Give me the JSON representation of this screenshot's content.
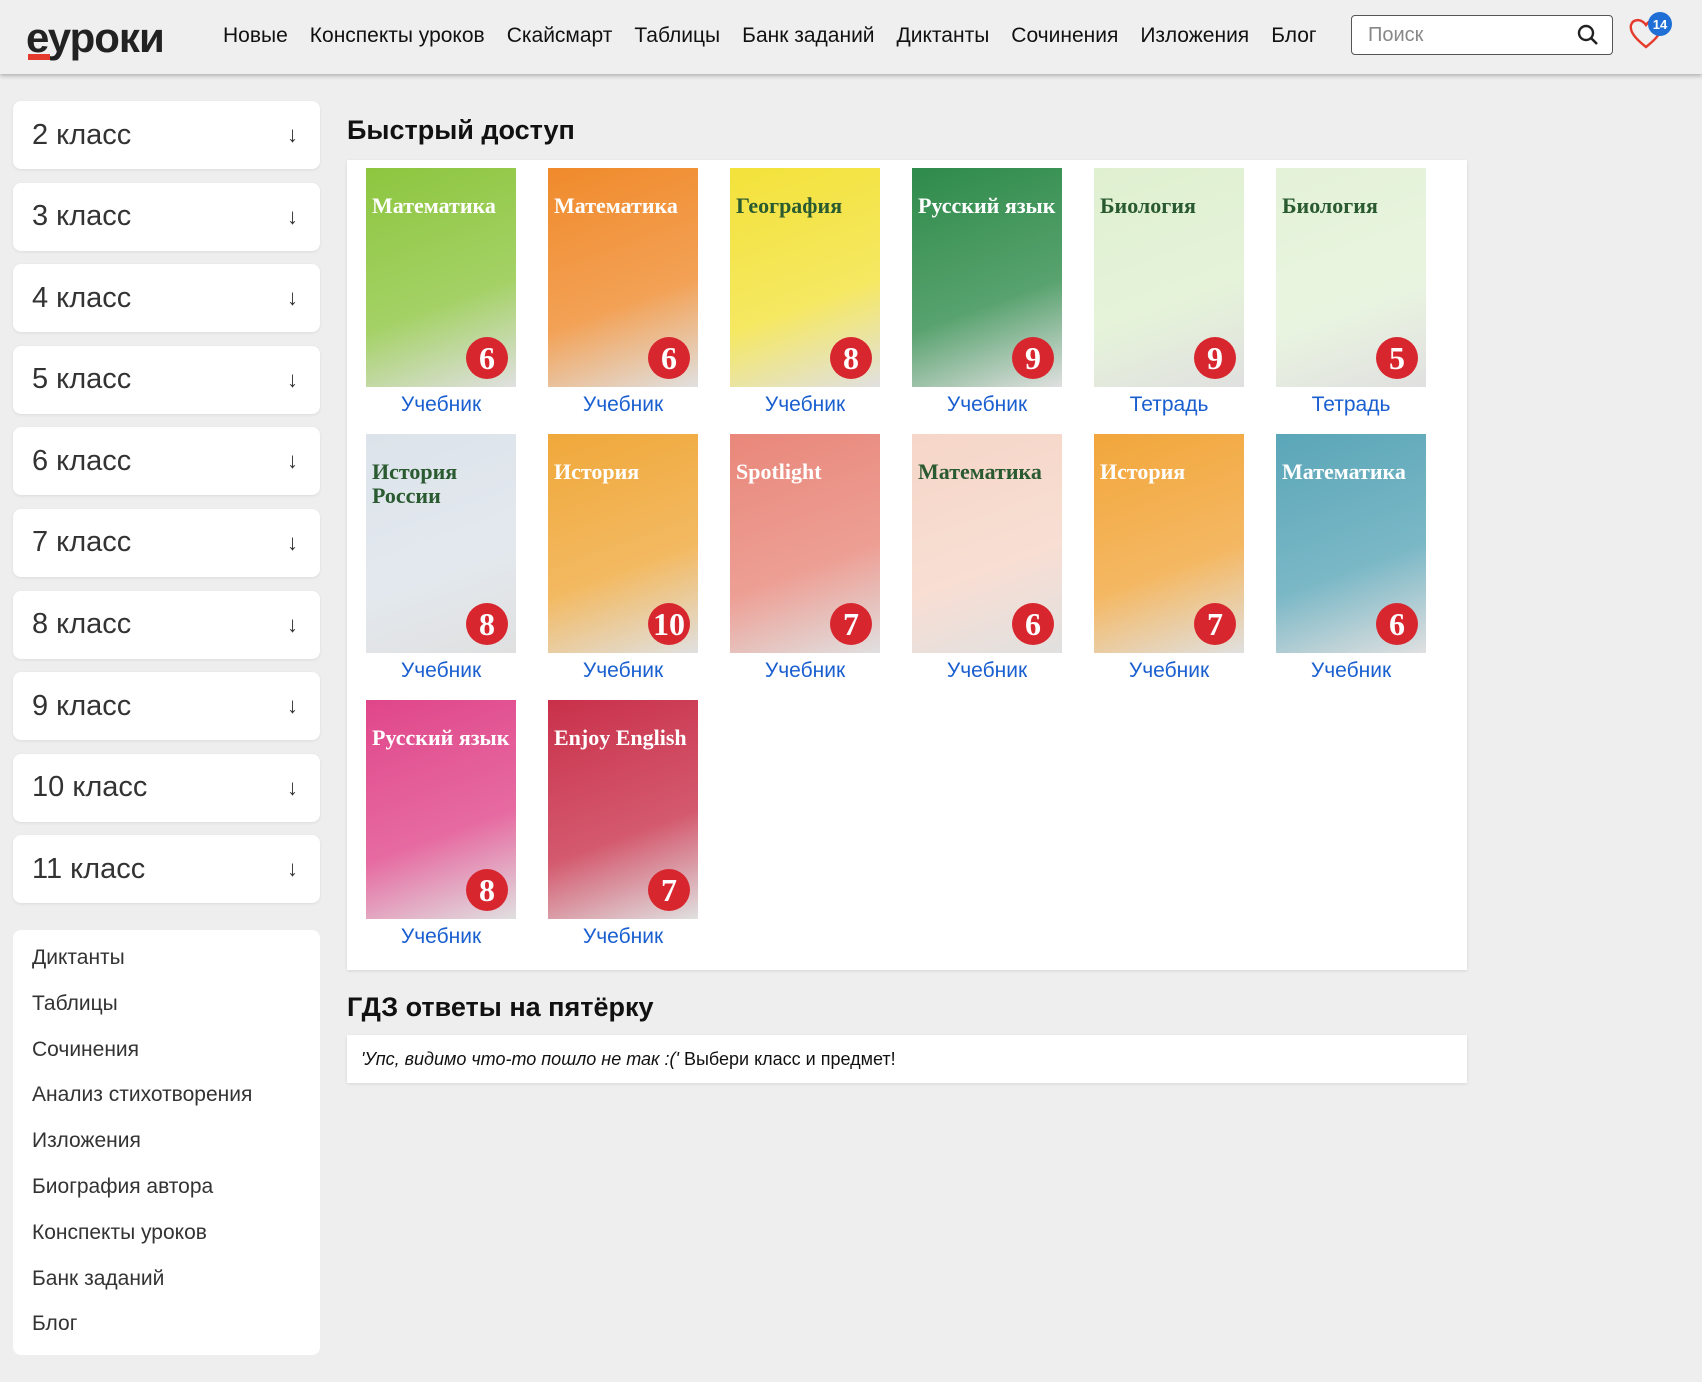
{
  "header": {
    "logo": "еуроки",
    "nav": [
      "Новые",
      "Конспекты уроков",
      "Скайсмарт",
      "Таблицы",
      "Банк заданий",
      "Диктанты",
      "Сочинения",
      "Изложения",
      "Блог"
    ],
    "search_placeholder": "Поиск",
    "favorites_count": "14"
  },
  "sidebar": {
    "classes": [
      "2 класс",
      "3 класс",
      "4 класс",
      "5 класс",
      "6 класс",
      "7 класс",
      "8 класс",
      "9 класс",
      "10 класс",
      "11 класс"
    ],
    "arrow": "↓",
    "links": [
      "Диктанты",
      "Таблицы",
      "Сочинения",
      "Анализ стихотворения",
      "Изложения",
      "Биография автора",
      "Конспекты уроков",
      "Банк заданий",
      "Блог"
    ]
  },
  "quick": {
    "title": "Быстрый доступ",
    "books": [
      {
        "title": "Математика",
        "grade": "6",
        "label": "Учебник",
        "color": "#8dc63f"
      },
      {
        "title": "Математика",
        "grade": "6",
        "label": "Учебник",
        "color": "#f08a2b"
      },
      {
        "title": "География",
        "grade": "8",
        "label": "Учебник",
        "color": "#f3e23a"
      },
      {
        "title": "Русский язык",
        "grade": "9",
        "label": "Учебник",
        "color": "#2e8b4a"
      },
      {
        "title": "Биология",
        "grade": "9",
        "label": "Тетрадь",
        "color": "#dff0d0"
      },
      {
        "title": "Биология",
        "grade": "5",
        "label": "Тетрадь",
        "color": "#e4f2d8"
      },
      {
        "title": "История России",
        "grade": "8",
        "label": "Учебник",
        "color": "#dce3ea"
      },
      {
        "title": "История",
        "grade": "10",
        "label": "Учебник",
        "color": "#f0a83a"
      },
      {
        "title": "Spotlight",
        "grade": "7",
        "label": "Учебник",
        "color": "#e9877a"
      },
      {
        "title": "Математика",
        "grade": "6",
        "label": "Учебник",
        "color": "#f6d6c8"
      },
      {
        "title": "История",
        "grade": "7",
        "label": "Учебник",
        "color": "#f2a63b"
      },
      {
        "title": "Математика",
        "grade": "6",
        "label": "Учебник",
        "color": "#5aa6b8"
      },
      {
        "title": "Русский язык",
        "grade": "8",
        "label": "Учебник",
        "color": "#e0468a"
      },
      {
        "title": "Enjoy English",
        "grade": "7",
        "label": "Учебник",
        "color": "#c9304a"
      }
    ]
  },
  "gdz": {
    "title": "ГДЗ ответы на пятёрку",
    "error_italic": "'Упс, видимо что-то пошло не так :('",
    "error_text": " Выбери класс и предмет!"
  }
}
